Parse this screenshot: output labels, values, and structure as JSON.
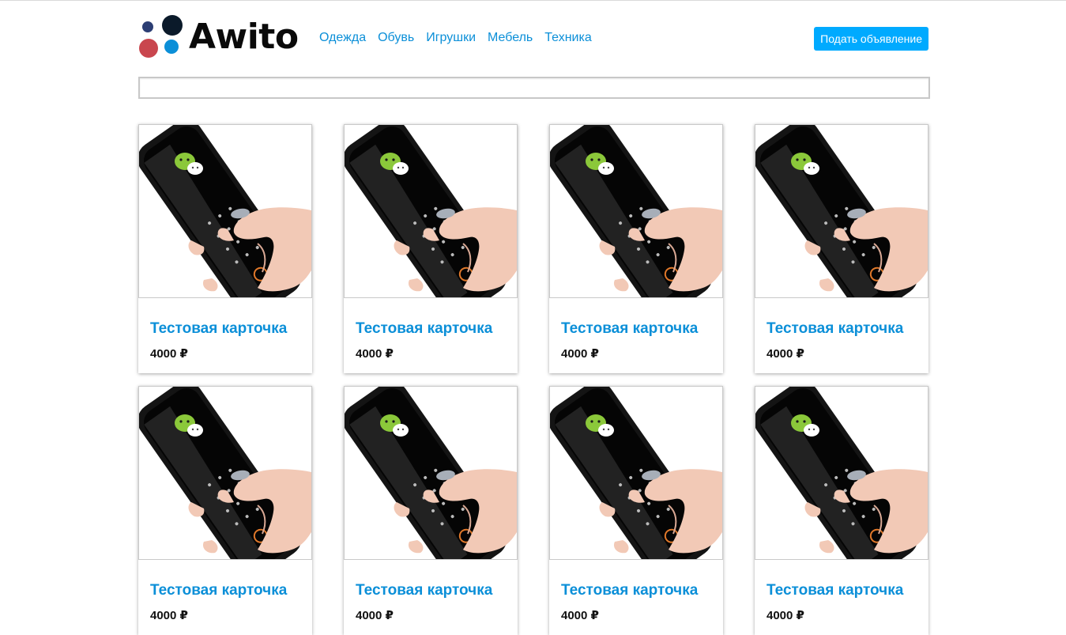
{
  "brand": {
    "name": "Awito",
    "dots": [
      "#2c3e74",
      "#0b1a2a",
      "#c9464e",
      "#0b8fd8"
    ]
  },
  "nav": [
    "Одежда",
    "Обувь",
    "Игрушки",
    "Мебель",
    "Техника"
  ],
  "header": {
    "post_button_label": "Подать объявление"
  },
  "search": {
    "value": "",
    "placeholder": ""
  },
  "cards": [
    {
      "title": "Тестовая карточка",
      "price": "4000 ₽"
    },
    {
      "title": "Тестовая карточка",
      "price": "4000 ₽"
    },
    {
      "title": "Тестовая карточка",
      "price": "4000 ₽"
    },
    {
      "title": "Тестовая карточка",
      "price": "4000 ₽"
    },
    {
      "title": "Тестовая карточка",
      "price": "4000 ₽"
    },
    {
      "title": "Тестовая карточка",
      "price": "4000 ₽"
    },
    {
      "title": "Тестовая карточка",
      "price": "4000 ₽"
    },
    {
      "title": "Тестовая карточка",
      "price": "4000 ₽"
    }
  ],
  "colors": {
    "accent": "#0b8fd8",
    "button": "#00aaff"
  },
  "icons": {
    "card_image": "phone-in-hand-image"
  }
}
